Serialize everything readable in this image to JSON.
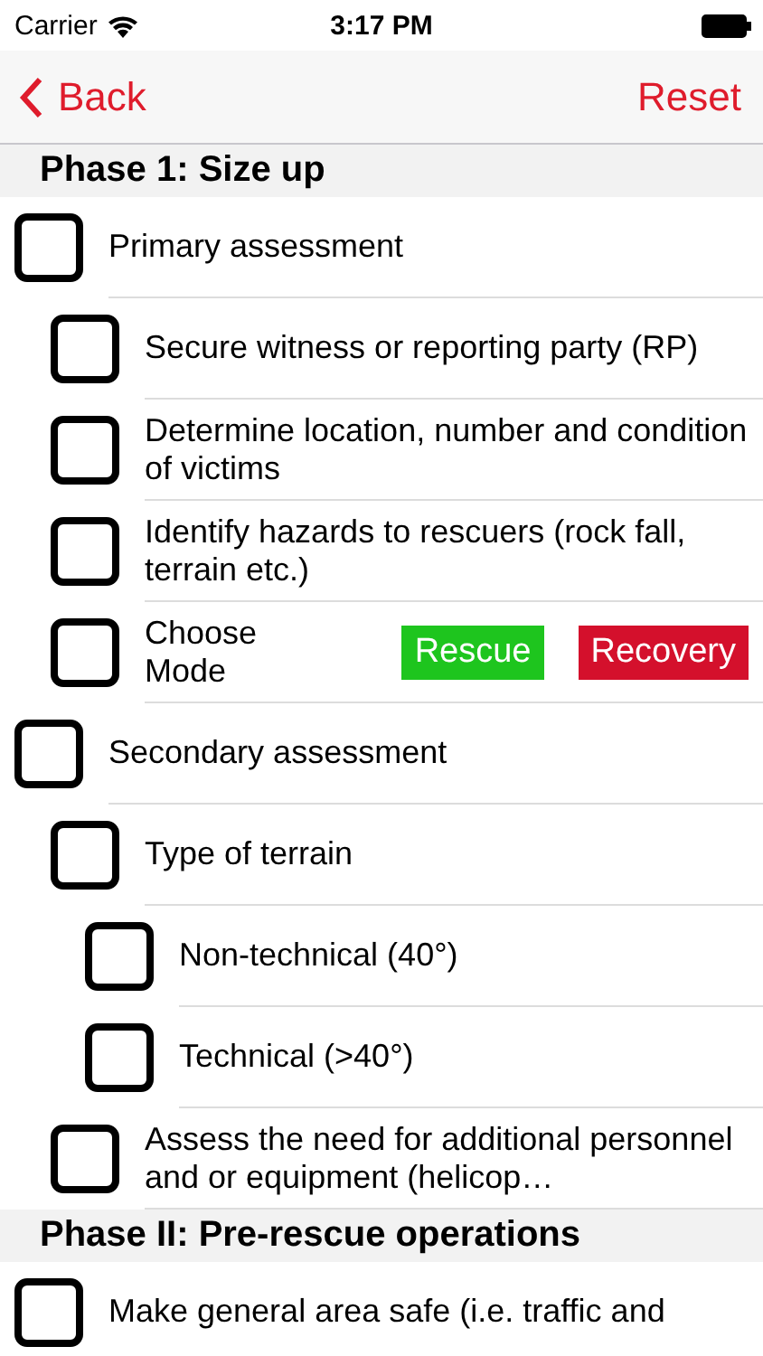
{
  "status_bar": {
    "carrier": "Carrier",
    "time": "3:17 PM"
  },
  "nav": {
    "back": "Back",
    "action": "Reset"
  },
  "sections": [
    {
      "title": "Phase 1: Size up",
      "items": [
        {
          "kind": "check",
          "label": "Primary assessment",
          "checked": false,
          "children": [
            {
              "kind": "check",
              "label": "Secure witness or reporting party (RP)",
              "checked": false
            },
            {
              "kind": "check",
              "label": "Determine location, number and condition of victims",
              "checked": false
            },
            {
              "kind": "check",
              "label": "Identify hazards to rescuers (rock fall, terrain etc.)",
              "checked": false
            },
            {
              "kind": "mode",
              "label": "Choose Mode",
              "checked": false,
              "options": [
                {
                  "label": "Rescue",
                  "color": "#1ec51e"
                },
                {
                  "label": "Recovery",
                  "color": "#d4102c"
                }
              ]
            }
          ]
        },
        {
          "kind": "check",
          "label": "Secondary assessment",
          "checked": false,
          "children": [
            {
              "kind": "check",
              "label": "Type of terrain",
              "checked": false,
              "children": [
                {
                  "kind": "check",
                  "label": "Non-technical (40°)",
                  "checked": false
                },
                {
                  "kind": "check",
                  "label": "Technical (>40°)",
                  "checked": false
                }
              ]
            },
            {
              "kind": "check",
              "label": "Assess the need for additional personnel and or equipment (helicop…",
              "checked": false
            }
          ]
        }
      ]
    },
    {
      "title": "Phase II: Pre-rescue operations",
      "items": [
        {
          "kind": "check",
          "label": "Make general area safe (i.e. traffic and",
          "checked": false
        }
      ]
    }
  ]
}
